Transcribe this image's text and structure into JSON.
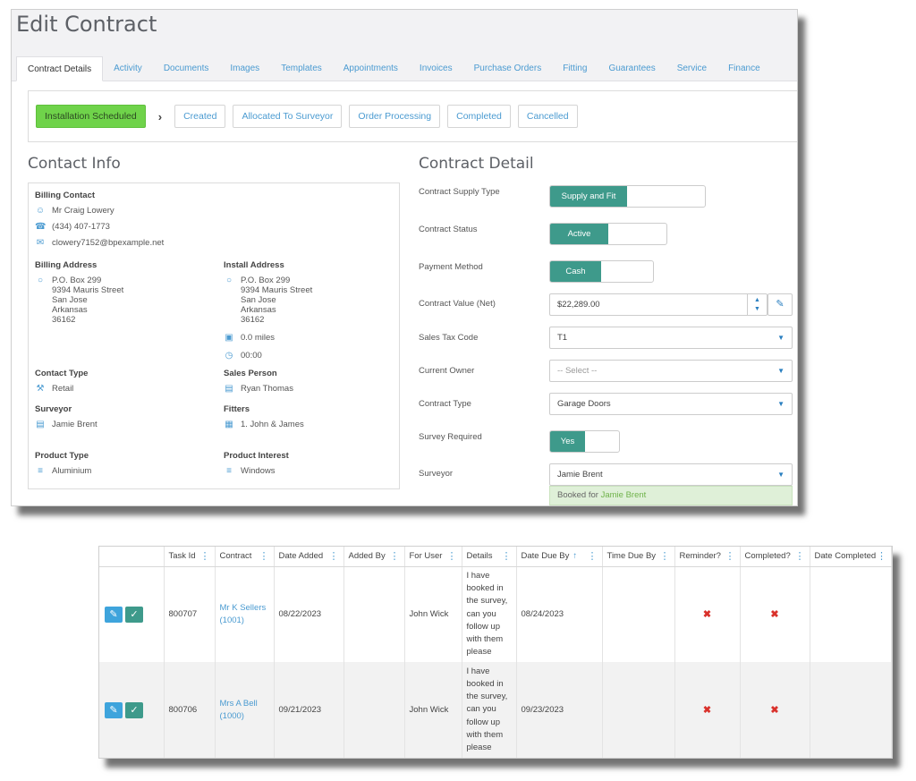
{
  "page": {
    "title": "Edit Contract"
  },
  "tabs": [
    "Contract Details",
    "Activity",
    "Documents",
    "Images",
    "Templates",
    "Appointments",
    "Invoices",
    "Purchase Orders",
    "Fitting",
    "Guarantees",
    "Service",
    "Finance"
  ],
  "stages": {
    "current": "Installation Scheduled",
    "others": [
      "Created",
      "Allocated To Surveyor",
      "Order Processing",
      "Completed",
      "Cancelled"
    ]
  },
  "contact_info": {
    "title": "Contact Info",
    "billing_contact": {
      "label": "Billing Contact",
      "name": "Mr Craig Lowery",
      "phone": "(434) 407-1773",
      "email": "clowery7152@bpexample.net"
    },
    "billing_address": {
      "label": "Billing Address",
      "lines": [
        "P.O. Box 299",
        "9394 Mauris Street",
        "San Jose",
        "Arkansas",
        "36162"
      ]
    },
    "install_address": {
      "label": "Install Address",
      "lines": [
        "P.O. Box 299",
        "9394 Mauris Street",
        "San Jose",
        "Arkansas",
        "36162"
      ],
      "distance": "0.0 miles",
      "time": "00:00"
    },
    "contact_type": {
      "label": "Contact Type",
      "value": "Retail"
    },
    "sales_person": {
      "label": "Sales Person",
      "value": "Ryan Thomas"
    },
    "surveyor": {
      "label": "Surveyor",
      "value": "Jamie Brent"
    },
    "fitters": {
      "label": "Fitters",
      "value": "1. John & James"
    },
    "product_type": {
      "label": "Product Type",
      "value": "Aluminium"
    },
    "product_interest": {
      "label": "Product Interest",
      "value": "Windows"
    }
  },
  "contract_detail": {
    "title": "Contract Detail",
    "supply_type": {
      "label": "Contract Supply Type",
      "value": "Supply and Fit"
    },
    "status": {
      "label": "Contract Status",
      "value": "Active"
    },
    "payment": {
      "label": "Payment Method",
      "value": "Cash"
    },
    "value_net": {
      "label": "Contract Value (Net)",
      "value": "$22,289.00"
    },
    "tax_code": {
      "label": "Sales Tax Code",
      "value": "T1"
    },
    "owner": {
      "label": "Current Owner",
      "placeholder": "-- Select --"
    },
    "contract_type": {
      "label": "Contract Type",
      "value": "Garage Doors"
    },
    "survey_required": {
      "label": "Survey Required",
      "value": "Yes"
    },
    "surveyor": {
      "label": "Surveyor",
      "value": "Jamie Brent"
    },
    "booked": {
      "prefix": "Booked for",
      "name": "Jamie Brent"
    }
  },
  "tasks": {
    "columns": [
      "Task Id",
      "Contract",
      "Date Added",
      "Added By",
      "For User",
      "Details",
      "Date Due By",
      "Time Due By",
      "Reminder?",
      "Completed?",
      "Date Completed"
    ],
    "rows": [
      {
        "task_id": "800707",
        "contract": "Mr K Sellers (1001)",
        "date_added": "08/22/2023",
        "added_by": "",
        "for_user": "John Wick",
        "details": "I have booked in the survey, can you follow up with them please",
        "date_due": "08/24/2023",
        "time_due": "",
        "date_completed": ""
      },
      {
        "task_id": "800706",
        "contract": "Mrs A Bell (1000)",
        "date_added": "09/21/2023",
        "added_by": "",
        "for_user": "John Wick",
        "details": "I have booked in the survey, can you follow up with them please",
        "date_due": "09/23/2023",
        "time_due": "",
        "date_completed": ""
      }
    ]
  },
  "icons": {
    "accent": "#4b9bd1",
    "teal": "#3e9a8b",
    "stage_green": "#6fd34a",
    "x_red": "#d9312b"
  }
}
